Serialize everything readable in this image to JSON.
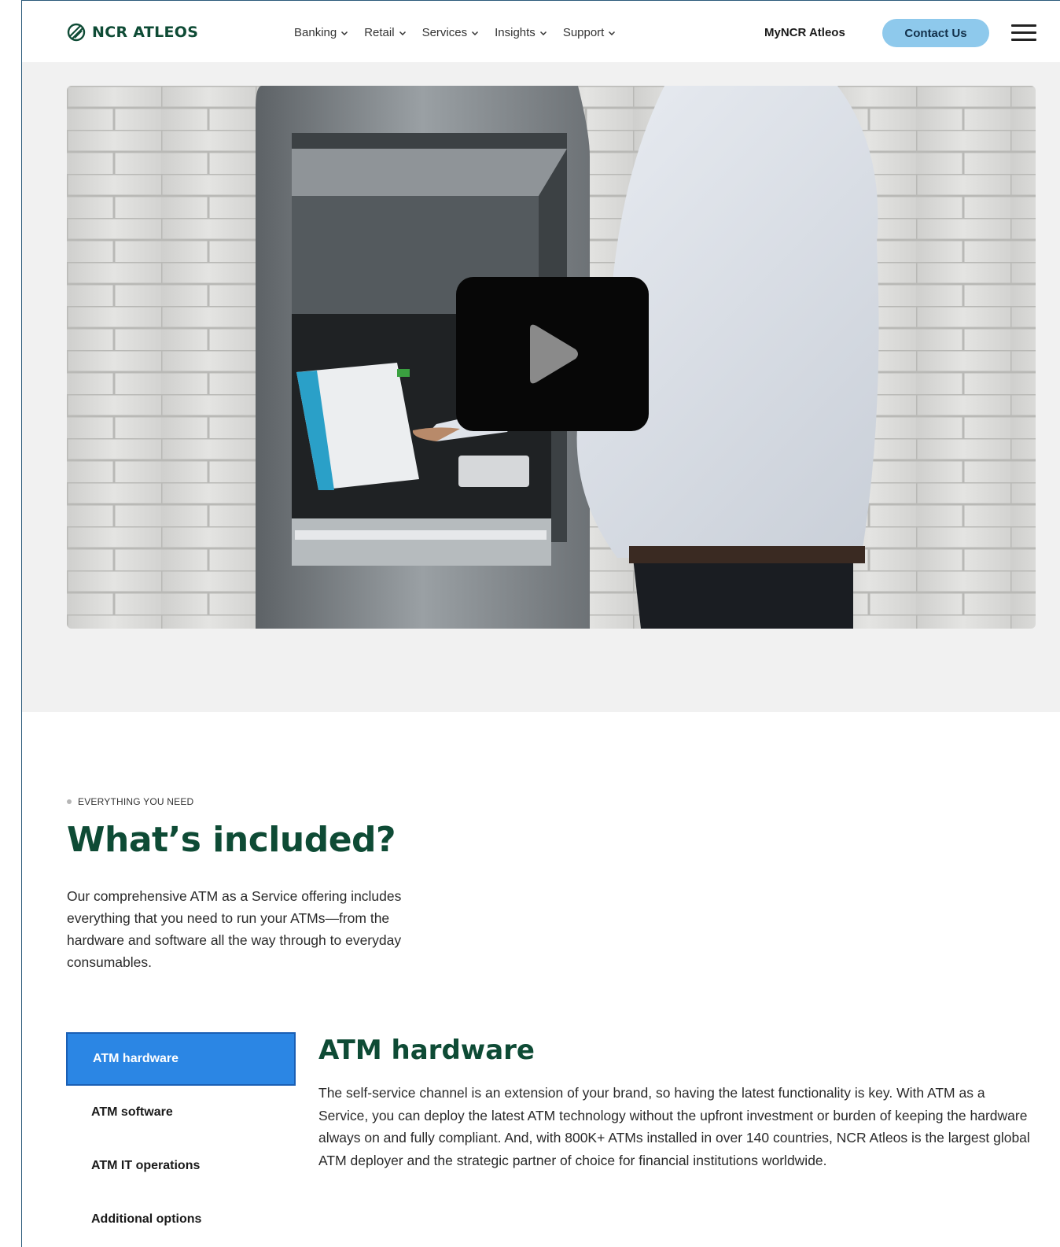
{
  "header": {
    "brand": "NCR ATLEOS",
    "nav": [
      {
        "label": "Banking"
      },
      {
        "label": "Retail"
      },
      {
        "label": "Services"
      },
      {
        "label": "Insights"
      },
      {
        "label": "Support"
      }
    ],
    "my_link": "MyNCR Atleos",
    "contact_label": "Contact Us",
    "menu_icon": "hamburger-icon"
  },
  "hero": {
    "image": "person-using-atm-photo",
    "play_icon": "play-icon"
  },
  "section": {
    "eyebrow": "EVERYTHING YOU NEED",
    "title": "What’s included?",
    "intro": "Our comprehensive ATM as a Service offering includes everything that you need to run your ATMs—from the hardware and software all the way through to everyday consumables."
  },
  "tabs": [
    {
      "label": "ATM hardware",
      "active": true
    },
    {
      "label": "ATM software",
      "active": false
    },
    {
      "label": "ATM IT operations",
      "active": false
    },
    {
      "label": "Additional options",
      "active": false
    }
  ],
  "panel": {
    "title": "ATM hardware",
    "body": "The self-service channel is an extension of your brand, so having the latest functionality is key. With ATM as a Service, you can deploy the latest ATM technology without the upfront investment or burden of keeping the hardware always on and fully compliant. And, with 800K+ ATMs installed in over 140 countries, NCR Atleos is the largest global ATM deployer and the strategic partner of choice for financial institutions worldwide."
  },
  "colors": {
    "brand_green": "#0e4b35",
    "contact_bg": "#8ec9ec",
    "active_tab": "#2b86e4"
  }
}
